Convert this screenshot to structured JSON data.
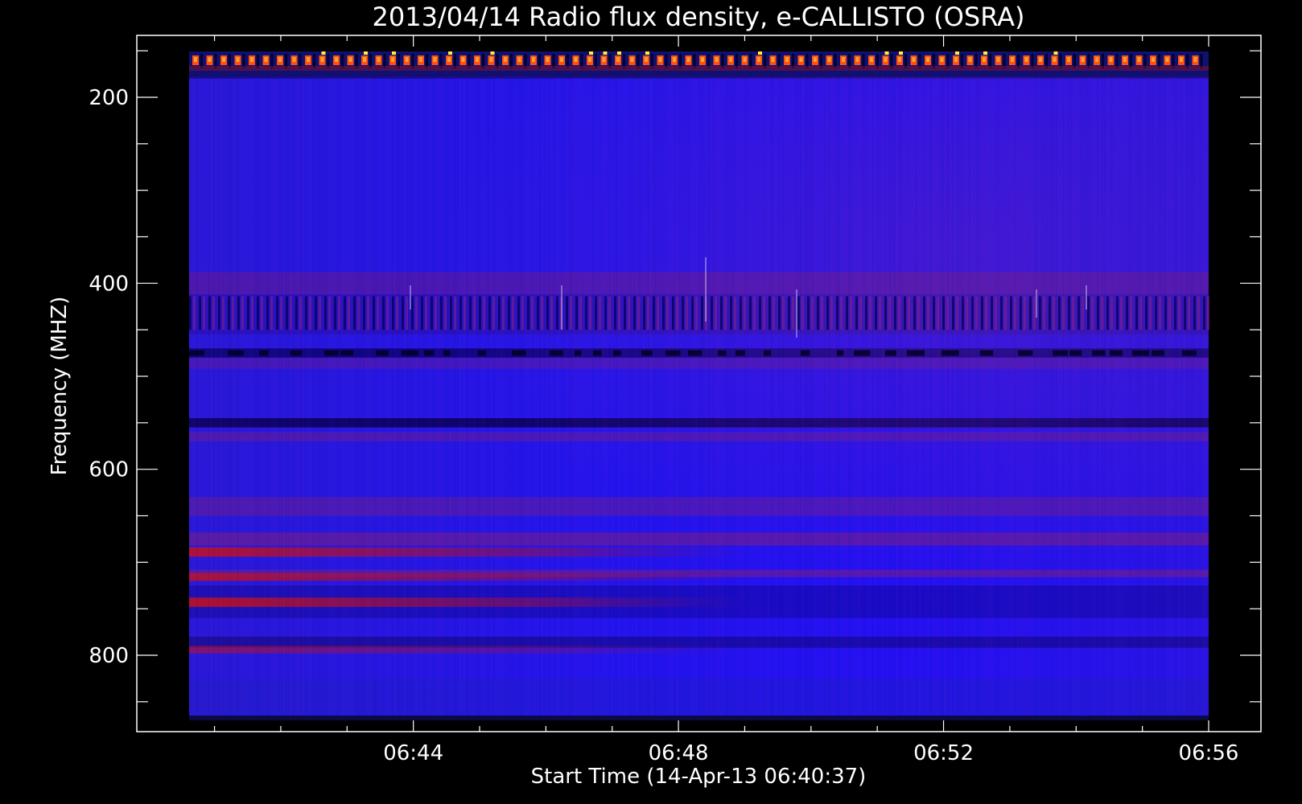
{
  "chart_data": {
    "type": "heatmap",
    "title": "2013/04/14  Radio flux density, e-CALLISTO (OSRA)",
    "xlabel": "Start Time (14-Apr-13 06:40:37)",
    "ylabel": "Frequency (MHZ)",
    "x_unit": "UT time",
    "xlim": [
      "06:40:37",
      "06:56:00"
    ],
    "ylim": [
      150,
      870
    ],
    "y_inverted": true,
    "x_ticks": [
      "06:44",
      "06:48",
      "06:52",
      "06:56"
    ],
    "y_ticks": [
      200,
      400,
      600,
      800
    ],
    "colormap": [
      "#000000",
      "#0000ff",
      "#ff0000",
      "#ff7f00",
      "#ffff00",
      "#ffffff"
    ],
    "background": "#000000",
    "features": [
      {
        "description": "Periodic bright calibration/interference pulses",
        "freq_range_mhz": [
          150,
          175
        ],
        "time_range": [
          "06:40:37",
          "06:56:00"
        ]
      },
      {
        "description": "Striped interference band",
        "freq_range_mhz": [
          410,
          455
        ],
        "time_range": [
          "06:40:37",
          "06:56:00"
        ]
      },
      {
        "description": "Enhanced emission bands",
        "freq_range_mhz": [
          680,
          750
        ],
        "time_range": [
          "06:40:37",
          "06:46:00"
        ]
      }
    ]
  }
}
